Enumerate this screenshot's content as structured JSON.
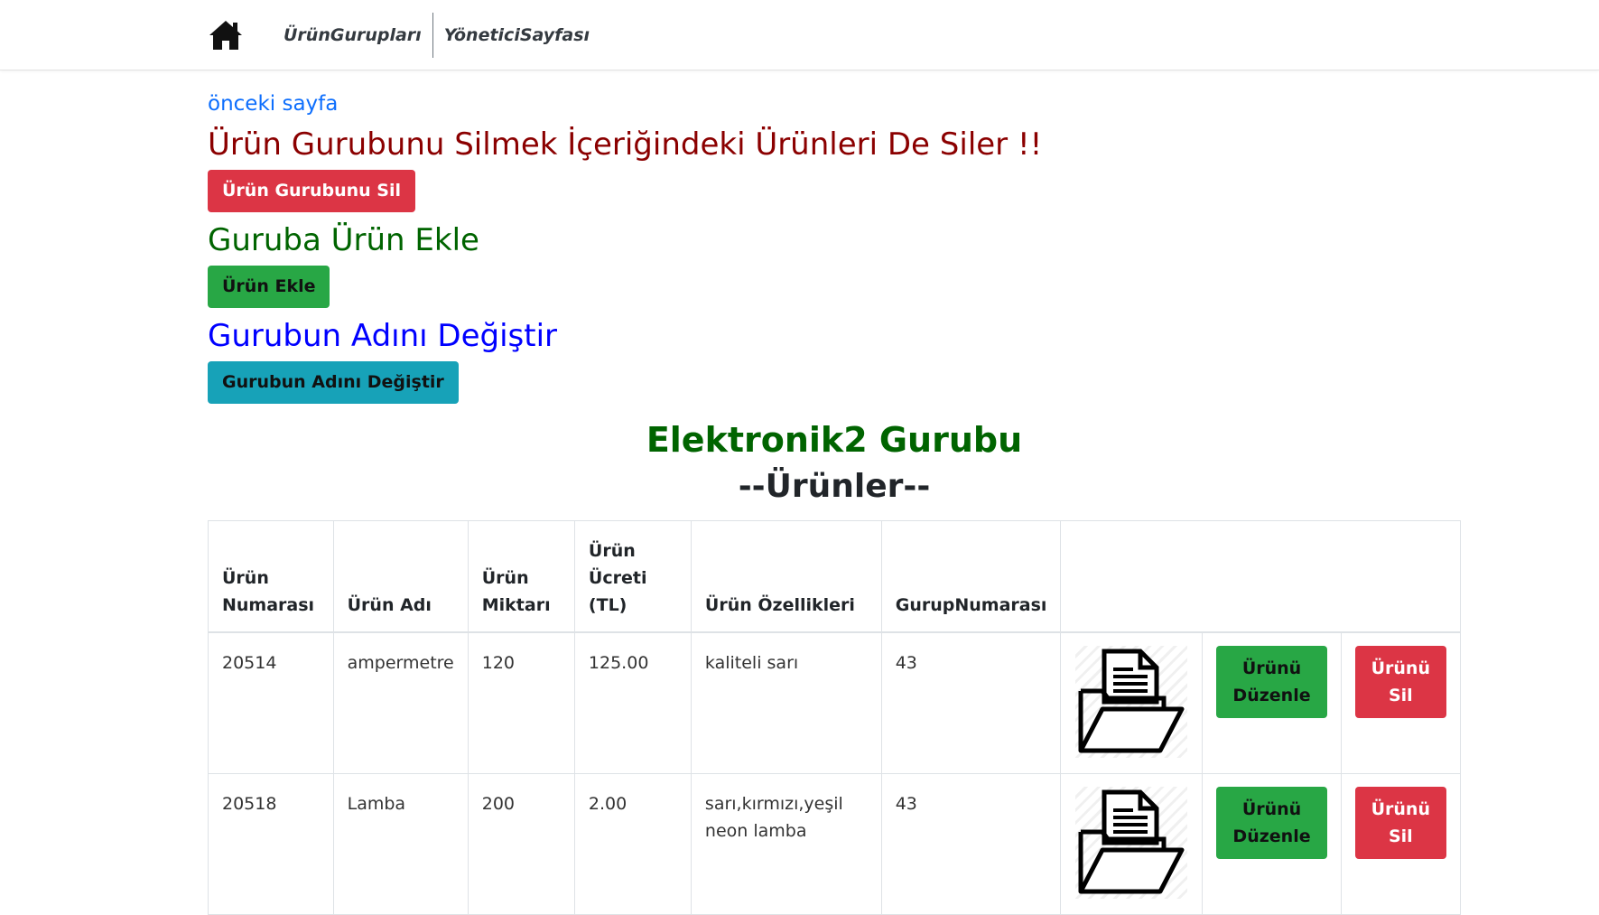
{
  "nav": {
    "home_icon": "home-icon",
    "link1": "ÜrünGurupları",
    "link2": "YöneticiSayfası"
  },
  "prev_link": "önceki sayfa",
  "warning": {
    "title": "Ürün Gurubunu Silmek İçeriğindeki Ürünleri De Siler !!",
    "button": "Ürün Gurubunu Sil"
  },
  "add": {
    "title": "Guruba Ürün Ekle",
    "button": "Ürün Ekle"
  },
  "rename": {
    "title": "Gurubun Adını Değiştir",
    "button": "Gurubun Adını Değiştir"
  },
  "group_title": "Elektronik2 Gurubu",
  "products_title": "--Ürünler--",
  "table": {
    "headers": [
      "Ürün Numarası",
      "Ürün Adı",
      "Ürün Miktarı",
      "Ürün Ücreti (TL)",
      "Ürün Özellikleri",
      "GurupNumarası"
    ],
    "rows": [
      {
        "no": "20514",
        "name": "ampermetre",
        "qty": "120",
        "price": "125.00",
        "features": "kaliteli sarı",
        "group": "43",
        "edit": "Ürünü Düzenle",
        "delete": "Ürünü Sil"
      },
      {
        "no": "20518",
        "name": "Lamba",
        "qty": "200",
        "price": "2.00",
        "features": "sarı,kırmızı,yeşil neon lamba",
        "group": "43",
        "edit": "Ürünü Düzenle",
        "delete": "Ürünü Sil"
      }
    ]
  },
  "colors": {
    "danger": "#dc3545",
    "success": "#28a745",
    "info": "#17a2b8",
    "link": "#0d6efd",
    "warning_text": "#8b0000",
    "green_text": "#006400",
    "blue_text": "#0000ff"
  }
}
